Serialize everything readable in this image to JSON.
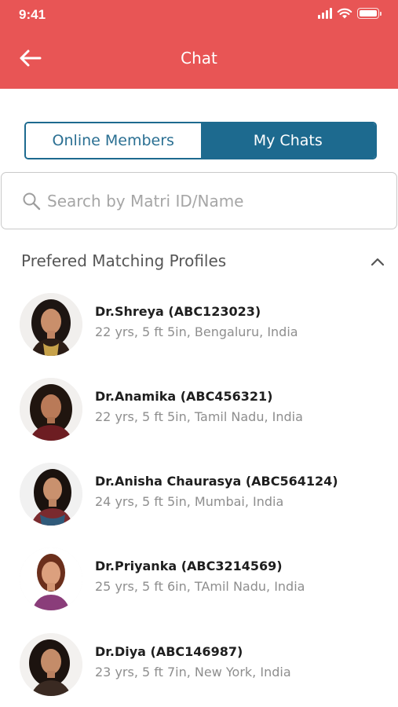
{
  "status_bar": {
    "time": "9:41"
  },
  "header": {
    "title": "Chat",
    "color": "#e85555"
  },
  "tabs": [
    {
      "label": "Online Members",
      "active": false
    },
    {
      "label": "My Chats",
      "active": true
    }
  ],
  "search": {
    "placeholder": "Search by Matri ID/Name",
    "value": ""
  },
  "section": {
    "title": "Prefered Matching Profiles",
    "expanded": true
  },
  "profiles": [
    {
      "name": "Dr.Shreya (ABC123023)",
      "details": "22 yrs, 5 ft 5in, Bengaluru, India"
    },
    {
      "name": "Dr.Anamika (ABC456321)",
      "details": "22 yrs, 5 ft 5in, Tamil Nadu, India"
    },
    {
      "name": "Dr.Anisha Chaurasya (ABC564124)",
      "details": "24 yrs, 5 ft 5in, Mumbai, India"
    },
    {
      "name": "Dr.Priyanka (ABC3214569)",
      "details": "25 yrs, 5 ft 6in, TAmil Nadu, India"
    },
    {
      "name": "Dr.Diya (ABC146987)",
      "details": "23 yrs, 5 ft 7in, New York, India"
    }
  ],
  "colors": {
    "accent": "#1d6a8f",
    "header": "#e85555"
  }
}
